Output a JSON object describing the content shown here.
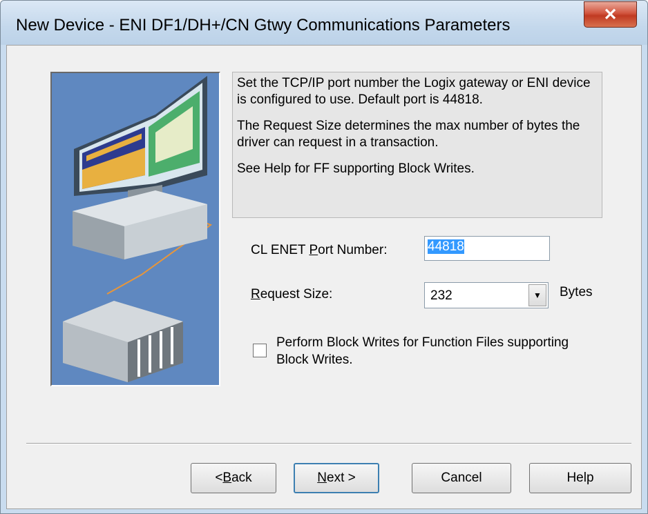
{
  "window": {
    "title": "New Device - ENI DF1/DH+/CN Gtwy Communications Parameters"
  },
  "help": {
    "paragraphs": [
      "Set the TCP/IP port number the Logix gateway or ENI device is configured to use.  Default port is 44818.",
      "The Request Size determines the max number of bytes the driver can request in a transaction.",
      "See Help for FF supporting Block Writes."
    ]
  },
  "port": {
    "label_pre": "CL ENET ",
    "label_key": "P",
    "label_post": "ort Number:",
    "value": "44818"
  },
  "request_size": {
    "label_key": "R",
    "label_post": "equest Size:",
    "value": "232",
    "unit": "Bytes"
  },
  "block_writes": {
    "line1": "Perform Block Writes for Function Files supporting",
    "line2": "Block Writes.",
    "checked": false
  },
  "buttons": {
    "back_pre": "< ",
    "back_key": "B",
    "back_post": "ack",
    "next_key": "N",
    "next_post": "ext >",
    "cancel": "Cancel",
    "help": "Help"
  },
  "colors": {
    "illustration_bg": "#5f88c0",
    "selection": "#3399ff",
    "close": "#c03a22"
  }
}
